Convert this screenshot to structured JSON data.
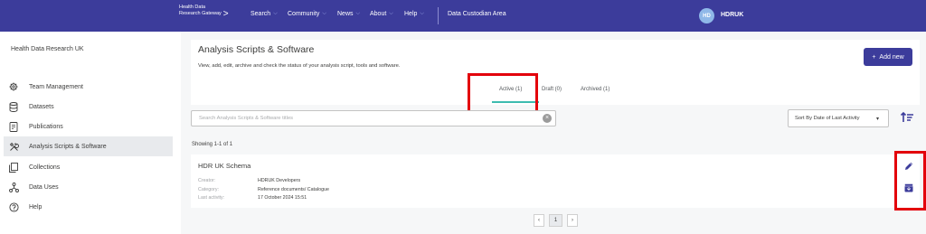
{
  "navbar": {
    "logo_line1": "Health Data",
    "logo_line2": "Research Gateway",
    "items": [
      {
        "label": "Search"
      },
      {
        "label": "Community"
      },
      {
        "label": "News"
      },
      {
        "label": "About"
      },
      {
        "label": "Help"
      }
    ],
    "custodian_link": "Data Custodian Area",
    "user_initials": "HD",
    "user_name": "HDRUK"
  },
  "sidebar": {
    "org_name": "Health Data Research UK",
    "items": [
      {
        "label": "Team Management",
        "icon": "gear-icon"
      },
      {
        "label": "Datasets",
        "icon": "database-icon"
      },
      {
        "label": "Publications",
        "icon": "document-icon"
      },
      {
        "label": "Analysis Scripts & Software",
        "icon": "tools-icon",
        "active": true
      },
      {
        "label": "Collections",
        "icon": "collections-icon"
      },
      {
        "label": "Data Uses",
        "icon": "network-icon"
      },
      {
        "label": "Help",
        "icon": "help-icon"
      }
    ]
  },
  "header": {
    "title": "Analysis Scripts & Software",
    "description": "View, add, edit, archive and check the status of your analysis script, tools and software.",
    "add_button": "Add new",
    "tabs": [
      {
        "label": "Active (1)",
        "active": true
      },
      {
        "label": "Draft (0)"
      },
      {
        "label": "Archived (1)"
      }
    ]
  },
  "filters": {
    "search_placeholder": "Search Analysis Scripts & Software titles",
    "sort_label": "Sort By Date of Last Activity"
  },
  "results": {
    "showing": "Showing 1-1 of 1",
    "items": [
      {
        "title": "HDR UK Schema",
        "creator_key": "Creator:",
        "creator": "HDRUK Developers",
        "category_key": "Category:",
        "category": "Reference documents/ Catalogue",
        "activity_key": "Last activity:",
        "last_activity": "17 October 2024 15:51"
      }
    ]
  },
  "pagination": {
    "prev": "‹",
    "current": "1",
    "next": "›"
  },
  "colors": {
    "brand": "#3c3c9b",
    "accent": "#3dbcb0",
    "highlight": "#e3000b"
  }
}
